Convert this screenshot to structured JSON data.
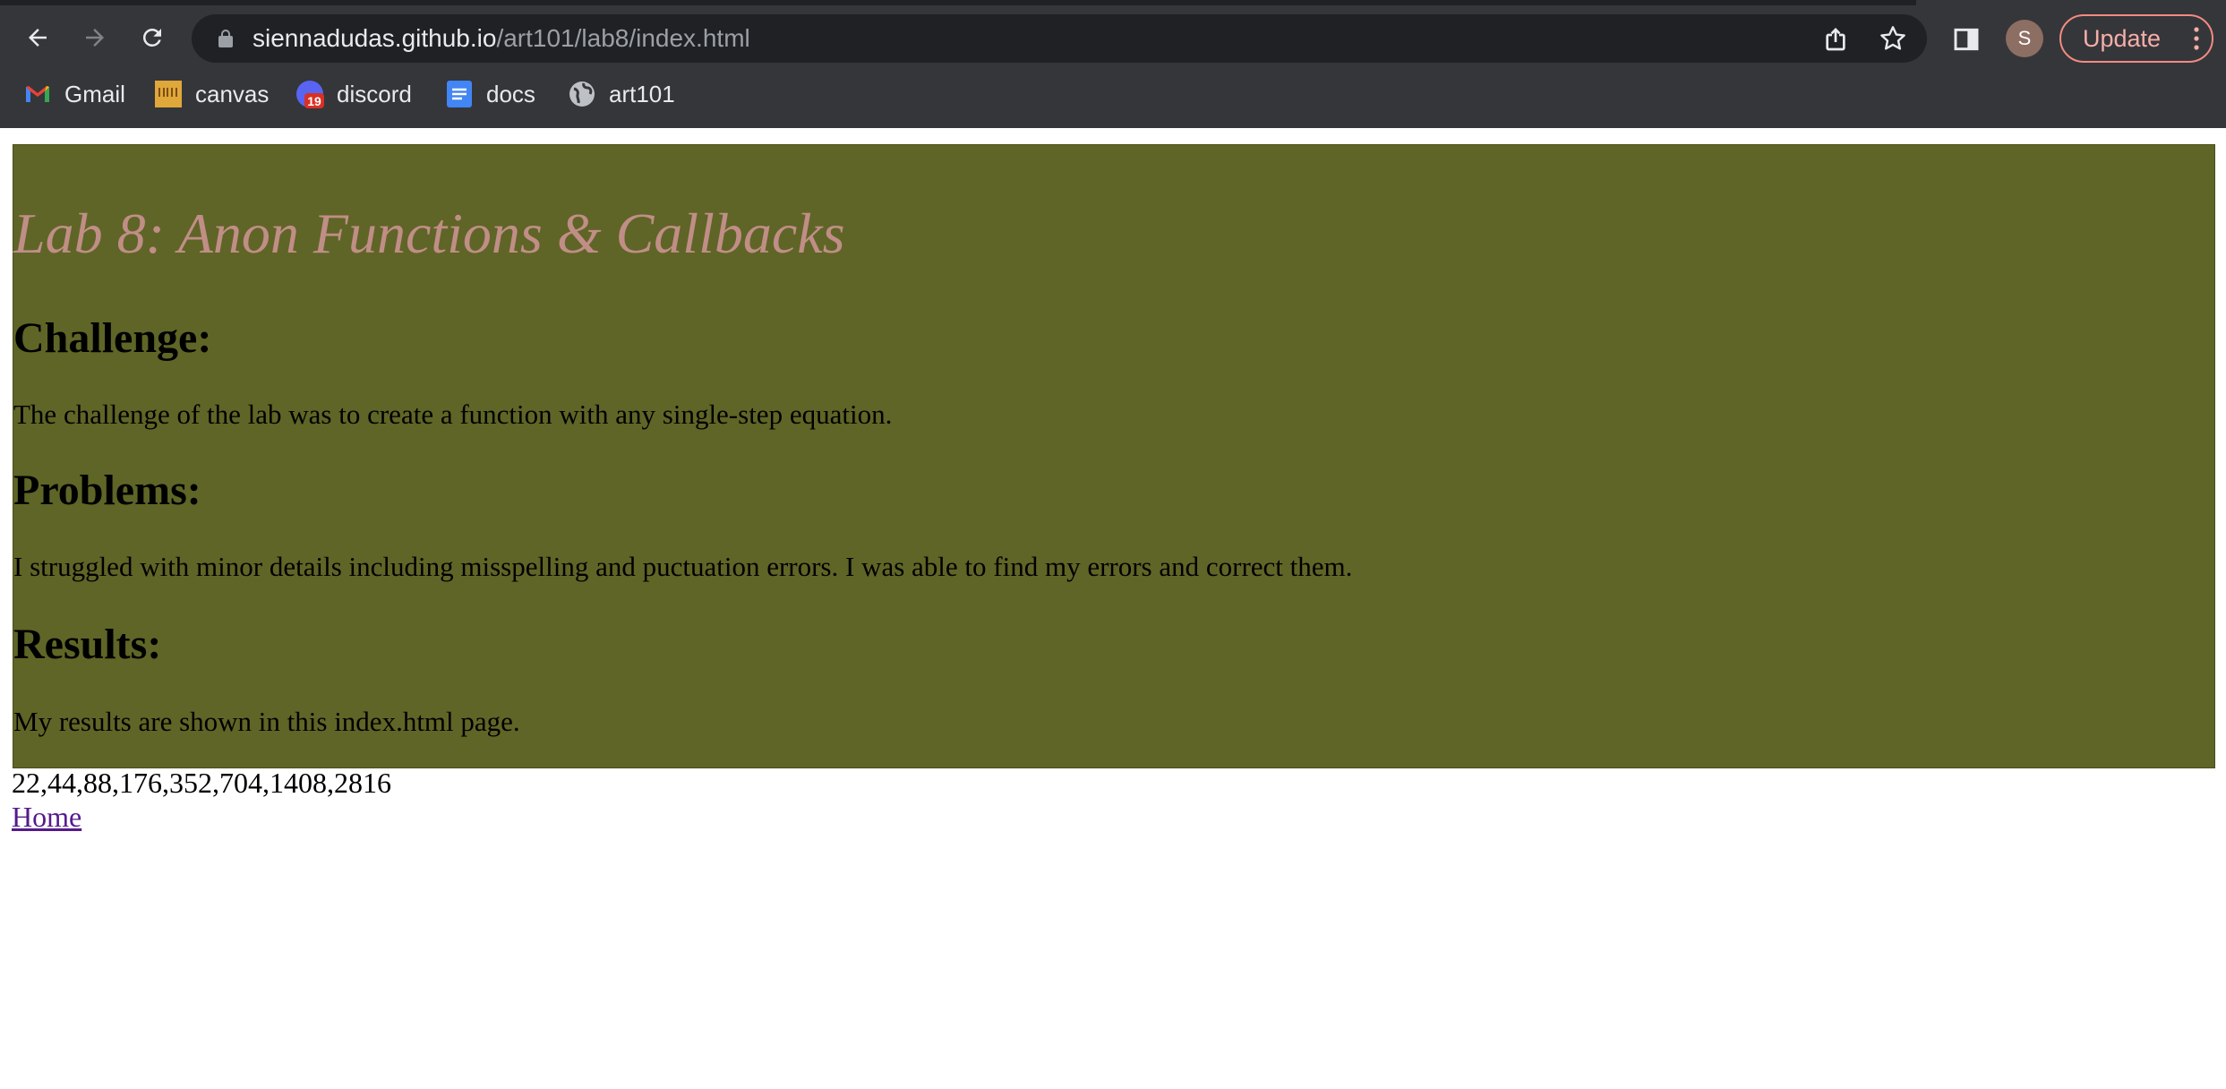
{
  "browser": {
    "url_host": "siennadudas.github.io",
    "url_path": "/art101/lab8/index.html",
    "profile_initial": "S",
    "update_label": "Update",
    "bookmarks": [
      {
        "label": "Gmail",
        "icon": "gmail-icon"
      },
      {
        "label": "canvas",
        "icon": "ucsc-icon"
      },
      {
        "label": "discord",
        "icon": "discord-icon",
        "badge": "19"
      },
      {
        "label": "docs",
        "icon": "docs-icon"
      },
      {
        "label": "art101",
        "icon": "globe-icon"
      }
    ]
  },
  "page": {
    "title": "Lab 8: Anon Functions & Callbacks",
    "challenge_heading": "Challenge:",
    "challenge_text": "The challenge of the lab was to create a function with any single-step equation.",
    "problems_heading": "Problems:",
    "problems_text": "I struggled with minor details including misspelling and puctuation errors. I was able to find my errors and correct them.",
    "results_heading": "Results:",
    "results_text": "My results are shown in this index.html page.",
    "output_values": "22,44,88,176,352,704,1408,2816",
    "home_link": "Home"
  },
  "colors": {
    "panel_bg": "#5f6526",
    "title_color": "#c08e87",
    "chrome_bg": "#35363a",
    "omnibox_bg": "#202124",
    "update_border": "#f28b82",
    "link_color": "#551a8b"
  }
}
